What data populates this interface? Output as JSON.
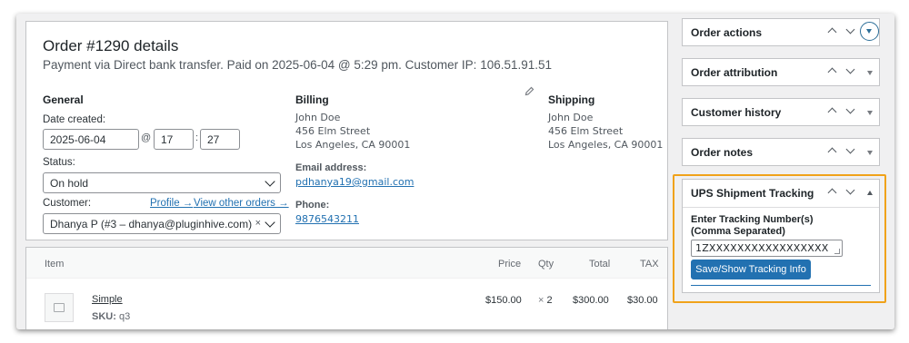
{
  "order": {
    "title": "Order #1290 details",
    "subtitle": "Payment via Direct bank transfer. Paid on 2025-06-04 @ 5:29 pm. Customer IP: 106.51.91.51"
  },
  "general": {
    "heading": "General",
    "date_label": "Date created:",
    "date_value": "2025-06-04",
    "at_sep": "@",
    "hour_value": "17",
    "time_sep": ":",
    "minute_value": "27",
    "status_label": "Status:",
    "status_value": "On hold",
    "customer_label": "Customer:",
    "profile_link": "Profile →",
    "other_orders_link": "View other orders →",
    "customer_value": "Dhanya P (#3 – dhanya@pluginhive.com)",
    "clear_glyph": "×"
  },
  "billing": {
    "heading": "Billing",
    "address": [
      "John Doe",
      "456 Elm Street",
      "Los Angeles, CA 90001"
    ],
    "email_label": "Email address:",
    "email_value": "pdhanya19@gmail.com",
    "phone_label": "Phone:",
    "phone_value": "9876543211",
    "edit_icon": "pencil-icon"
  },
  "shipping": {
    "heading": "Shipping",
    "address": [
      "John Doe",
      "456 Elm Street",
      "Los Angeles, CA 90001"
    ]
  },
  "items": {
    "columns": {
      "item": "Item",
      "price": "Price",
      "qty": "Qty",
      "total": "Total",
      "tax": "TAX"
    },
    "rows": [
      {
        "name": "Simple",
        "sku_label": "SKU:",
        "sku": "q3",
        "price": "$150.00",
        "qty_prefix": "×",
        "qty": "2",
        "total": "$300.00",
        "tax": "$30.00"
      }
    ]
  },
  "sidebar": {
    "boxes": [
      {
        "title": "Order actions"
      },
      {
        "title": "Order attribution"
      },
      {
        "title": "Customer history"
      },
      {
        "title": "Order notes"
      }
    ],
    "ups": {
      "title": "UPS Shipment Tracking",
      "field_label_1": "Enter Tracking Number(s)",
      "field_label_2": "(Comma Separated)",
      "tracking_value": "1ZXXXXXXXXXXXXXXXXX",
      "button_label": "Save/Show Tracking Info",
      "highlight_color": "#f0a21a"
    }
  },
  "colors": {
    "accent": "#2271b1",
    "text": "#1d2327",
    "muted": "#50575e"
  }
}
